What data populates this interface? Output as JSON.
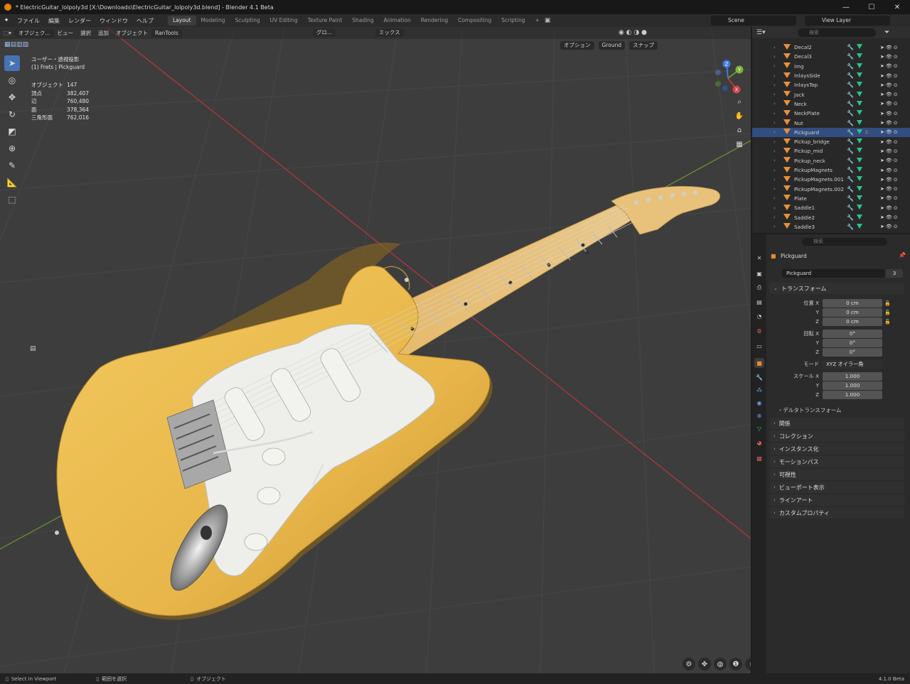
{
  "window": {
    "title": "* ElectricGuitar_lolpoly3d [X:\\Downloads\\ElectricGuitar_lolpoly3d.blend] - Blender 4.1 Beta",
    "buttons": [
      "—",
      "☐",
      "✕"
    ]
  },
  "menubar": {
    "items": [
      "ファイル",
      "編集",
      "レンダー",
      "ウィンドウ",
      "ヘルプ"
    ],
    "workspaces": [
      "Layout",
      "Modeling",
      "Sculpting",
      "UV Editing",
      "Texture Paint",
      "Shading",
      "Animation",
      "Rendering",
      "Compositing",
      "Scripting"
    ],
    "active_workspace": "Layout",
    "add_tab": "+",
    "scene": "Scene",
    "view_layer": "View Layer"
  },
  "viewport_header": {
    "mode": "オブジェク...",
    "menus": [
      "ビュー",
      "選択",
      "追加",
      "オブジェクト",
      "RanTools"
    ],
    "transform_orientation": "グロ...",
    "proportional": "ミックス",
    "options": "オプション",
    "snap_target": "Ground",
    "snap": "スナップ"
  },
  "viewport_overlay": {
    "view_name": "ユーザー・透視投影",
    "object_context": "(1) Frets | Pickguard",
    "stats": [
      {
        "label": "オブジェクト",
        "value": "147"
      },
      {
        "label": "頂点",
        "value": "382,407"
      },
      {
        "label": "辺",
        "value": "760,480"
      },
      {
        "label": "面",
        "value": "378,364"
      },
      {
        "label": "三角形面",
        "value": "762,016"
      }
    ],
    "gizmo_axes": [
      "X",
      "Y",
      "Z"
    ]
  },
  "outliner": {
    "search_placeholder": "検索",
    "items": [
      {
        "name": "Decal2",
        "selected": false
      },
      {
        "name": "Decal3",
        "selected": false
      },
      {
        "name": "img",
        "selected": false
      },
      {
        "name": "InlaysSide",
        "selected": false
      },
      {
        "name": "InlaysTop",
        "selected": false
      },
      {
        "name": "Jack",
        "selected": false
      },
      {
        "name": "Neck",
        "selected": false
      },
      {
        "name": "NeckPlate",
        "selected": false
      },
      {
        "name": "Nut",
        "selected": false
      },
      {
        "name": "Pickguard",
        "selected": true
      },
      {
        "name": "Pickup_bridge",
        "selected": false
      },
      {
        "name": "Pickup_mid",
        "selected": false
      },
      {
        "name": "Pickup_neck",
        "selected": false
      },
      {
        "name": "PickupMagnets",
        "selected": false
      },
      {
        "name": "PickupMagnets.001",
        "selected": false
      },
      {
        "name": "PickupMagnets.002",
        "selected": false
      },
      {
        "name": "Plate",
        "selected": false
      },
      {
        "name": "Saddle1",
        "selected": false
      },
      {
        "name": "Saddle2",
        "selected": false
      },
      {
        "name": "Saddle3",
        "selected": false
      }
    ],
    "pickguard_badge": "2"
  },
  "properties": {
    "search_placeholder": "検索",
    "object_name": "Pickguard",
    "datablock_name": "Pickguard",
    "datablock_users": "3",
    "transform": {
      "header": "トランスフォーム",
      "location_label": "位置 X",
      "location": [
        "0 cm",
        "0 cm",
        "0 cm"
      ],
      "rotation_label": "回転 X",
      "rotation": [
        "0°",
        "0°",
        "0°"
      ],
      "mode_label": "モード",
      "mode": "XYZ オイラー角",
      "scale_label": "スケール X",
      "scale": [
        "1.000",
        "1.000",
        "1.000"
      ],
      "axis_y": "Y",
      "axis_z": "Z",
      "delta": "デルタトランスフォーム"
    },
    "panels": [
      "関係",
      "コレクション",
      "インスタンス化",
      "モーションパス",
      "可視性",
      "ビューポート表示",
      "ラインアート",
      "カスタムプロパティ"
    ]
  },
  "statusbar": {
    "left": "Select in Viewport",
    "middle": "範囲を選択",
    "right": "オブジェクト",
    "version": "4.1.0 Beta"
  },
  "colors": {
    "accent": "#4772b3",
    "guitar_body": "#e8b64a",
    "pickguard": "#eeeeea",
    "neck": "#e6c27a",
    "grid": "#474747",
    "axis_x": "#b8383c",
    "axis_y": "#6d9a2c"
  }
}
